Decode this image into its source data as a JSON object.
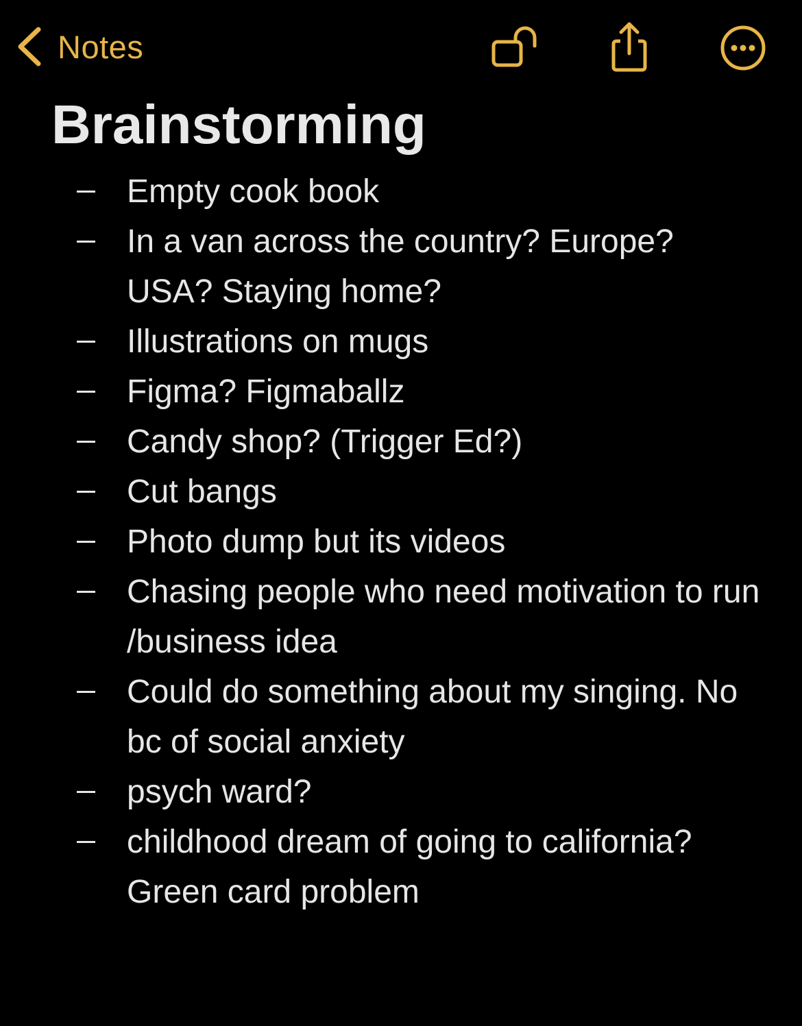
{
  "nav": {
    "back_label": "Notes",
    "back_icon": "chevron-left-icon",
    "lock_icon": "unlocked-padlock-icon",
    "share_icon": "share-icon",
    "more_icon": "ellipsis-circle-icon"
  },
  "note": {
    "title": "Brainstorming",
    "items": [
      {
        "text": "Empty cook book"
      },
      {
        "text": "In a van across the country? Europe? USA? Staying home?"
      },
      {
        "text": "Illustrations on mugs"
      },
      {
        "text": "Figma? Figmaballz"
      },
      {
        "text": "Candy shop? (Trigger Ed?)"
      },
      {
        "text": "Cut bangs"
      },
      {
        "text": "Photo dump but its videos"
      },
      {
        "text": "Chasing people who need motivation to run /business idea"
      },
      {
        "text": "Could do something about my singing. No bc of social anxiety"
      },
      {
        "text": "psych ward?"
      },
      {
        "text": "childhood dream of going to california? Green card problem"
      }
    ]
  },
  "colors": {
    "accent": "#e7b548",
    "background": "#000000",
    "text": "#e6e6e6"
  }
}
